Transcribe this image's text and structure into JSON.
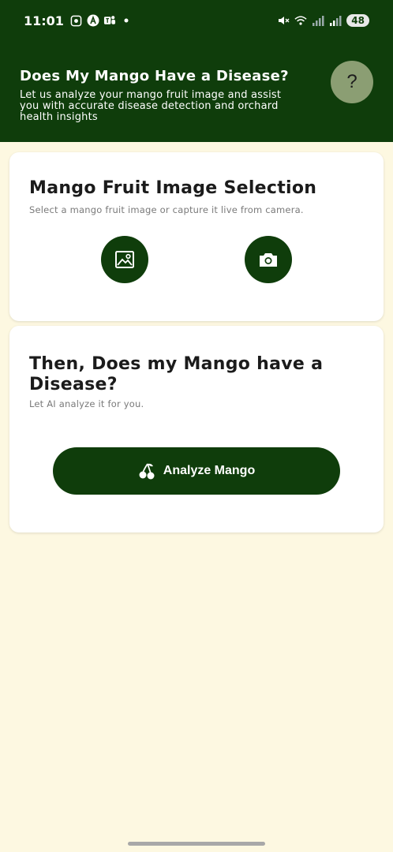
{
  "status_bar": {
    "time": "11:01",
    "battery": "48",
    "left_icons": [
      "screen-record-icon",
      "a-logo-icon",
      "teams-icon",
      "dot-icon"
    ],
    "right_icons": [
      "mute-icon",
      "wifi-icon",
      "signal-icon",
      "signal-icon"
    ]
  },
  "header": {
    "title": "Does My Mango Have a Disease?",
    "description": "Let us analyze your mango fruit image and assist you with accurate disease detection and orchard health insights",
    "help_label": "?",
    "background": "#0f3d0b"
  },
  "selection_card": {
    "title": "Mango Fruit Image Selection",
    "subtitle": "Select a mango fruit image or capture it live from camera.",
    "gallery_icon": "image-icon",
    "camera_icon": "camera-icon"
  },
  "analyze_card": {
    "title": "Then, Does my Mango have a Disease?",
    "subtitle": "Let AI analyze it for you.",
    "button_label": "Analyze Mango",
    "button_icon": "cherry-icon"
  },
  "colors": {
    "primary": "#0f3d0b",
    "background": "#fdf8e1",
    "help_button": "#8b9e73"
  }
}
